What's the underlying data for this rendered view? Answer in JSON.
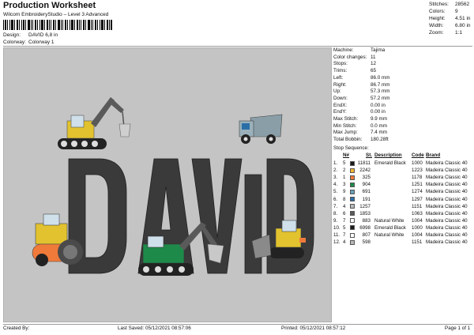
{
  "header": {
    "title": "Production Worksheet",
    "subtitle": "Wilcom EmbroideryStudio – Level 3 Advanced",
    "design_label": "Design:",
    "design_value": "DAVID 6,8 in",
    "colorway_label": "Colorway:",
    "colorway_value": "Colorway 1"
  },
  "stats": [
    {
      "label": "Stitches:",
      "value": "28562"
    },
    {
      "label": "Colors:",
      "value": "9"
    },
    {
      "label": "Height:",
      "value": "4.51 in"
    },
    {
      "label": "Width:",
      "value": "6.80 in"
    },
    {
      "label": "Zoom:",
      "value": "1:1"
    }
  ],
  "design_text": "DAVID",
  "properties": [
    {
      "label": "Machine:",
      "value": "Tajima"
    },
    {
      "label": "Color changes:",
      "value": "11"
    },
    {
      "label": "Stops:",
      "value": "12"
    },
    {
      "label": "Trims:",
      "value": "65"
    },
    {
      "label": "Left:",
      "value": "86.0 mm"
    },
    {
      "label": "Right:",
      "value": "86.7 mm"
    },
    {
      "label": "Up:",
      "value": "57.3 mm"
    },
    {
      "label": "Down:",
      "value": "57.2 mm"
    },
    {
      "label": "EndX:",
      "value": "0.00 in"
    },
    {
      "label": "EndY:",
      "value": "0.00 in"
    },
    {
      "label": "Max Stitch:",
      "value": "9.9 mm"
    },
    {
      "label": "Min Stitch:",
      "value": "0.0 mm"
    },
    {
      "label": "Max Jump:",
      "value": "7.4 mm"
    },
    {
      "label": "Total Bobbin:",
      "value": "180.28ft"
    }
  ],
  "sequence": {
    "title": "Stop Sequence:",
    "headers": [
      "N#",
      "St.",
      "Description",
      "Code",
      "Brand"
    ],
    "rows": [
      {
        "stop": "1.",
        "n": "5",
        "color": "#1a1a1a",
        "st": "11811",
        "desc": "Emerald Black",
        "code": "1000",
        "brand": "Madeira Classic 40"
      },
      {
        "stop": "2.",
        "n": "2",
        "color": "#f2b632",
        "st": "2242",
        "desc": "",
        "code": "1223",
        "brand": "Madeira Classic 40"
      },
      {
        "stop": "3.",
        "n": "1",
        "color": "#f07a3a",
        "st": "325",
        "desc": "",
        "code": "1178",
        "brand": "Madeira Classic 40"
      },
      {
        "stop": "4.",
        "n": "3",
        "color": "#1e8a4a",
        "st": "904",
        "desc": "",
        "code": "1251",
        "brand": "Madeira Classic 40"
      },
      {
        "stop": "5.",
        "n": "9",
        "color": "#6aa0b8",
        "st": "691",
        "desc": "",
        "code": "1274",
        "brand": "Madeira Classic 40"
      },
      {
        "stop": "6.",
        "n": "8",
        "color": "#2a6ea8",
        "st": "191",
        "desc": "",
        "code": "1297",
        "brand": "Madeira Classic 40"
      },
      {
        "stop": "7.",
        "n": "4",
        "color": "#b8b8b8",
        "st": "1257",
        "desc": "",
        "code": "1151",
        "brand": "Madeira Classic 40"
      },
      {
        "stop": "8.",
        "n": "6",
        "color": "#5a5a5a",
        "st": "1853",
        "desc": "",
        "code": "1063",
        "brand": "Madeira Classic 40"
      },
      {
        "stop": "9.",
        "n": "7",
        "color": "#ffffff",
        "st": "883",
        "desc": "Natural White",
        "code": "1004",
        "brand": "Madeira Classic 40"
      },
      {
        "stop": "10.",
        "n": "5",
        "color": "#1a1a1a",
        "st": "6998",
        "desc": "Emerald Black",
        "code": "1000",
        "brand": "Madeira Classic 40"
      },
      {
        "stop": "11.",
        "n": "7",
        "color": "#ffffff",
        "st": "807",
        "desc": "Natural White",
        "code": "1004",
        "brand": "Madeira Classic 40"
      },
      {
        "stop": "12.",
        "n": "4",
        "color": "#b8b8b8",
        "st": "598",
        "desc": "",
        "code": "1151",
        "brand": "Madeira Classic 40"
      }
    ]
  },
  "footer": {
    "created_by": "Created By:",
    "last_saved": "Last Saved: 05/12/2021 08:57:06",
    "printed": "Printed: 05/12/2021 08:57:12",
    "page": "Page 1 of 1"
  }
}
